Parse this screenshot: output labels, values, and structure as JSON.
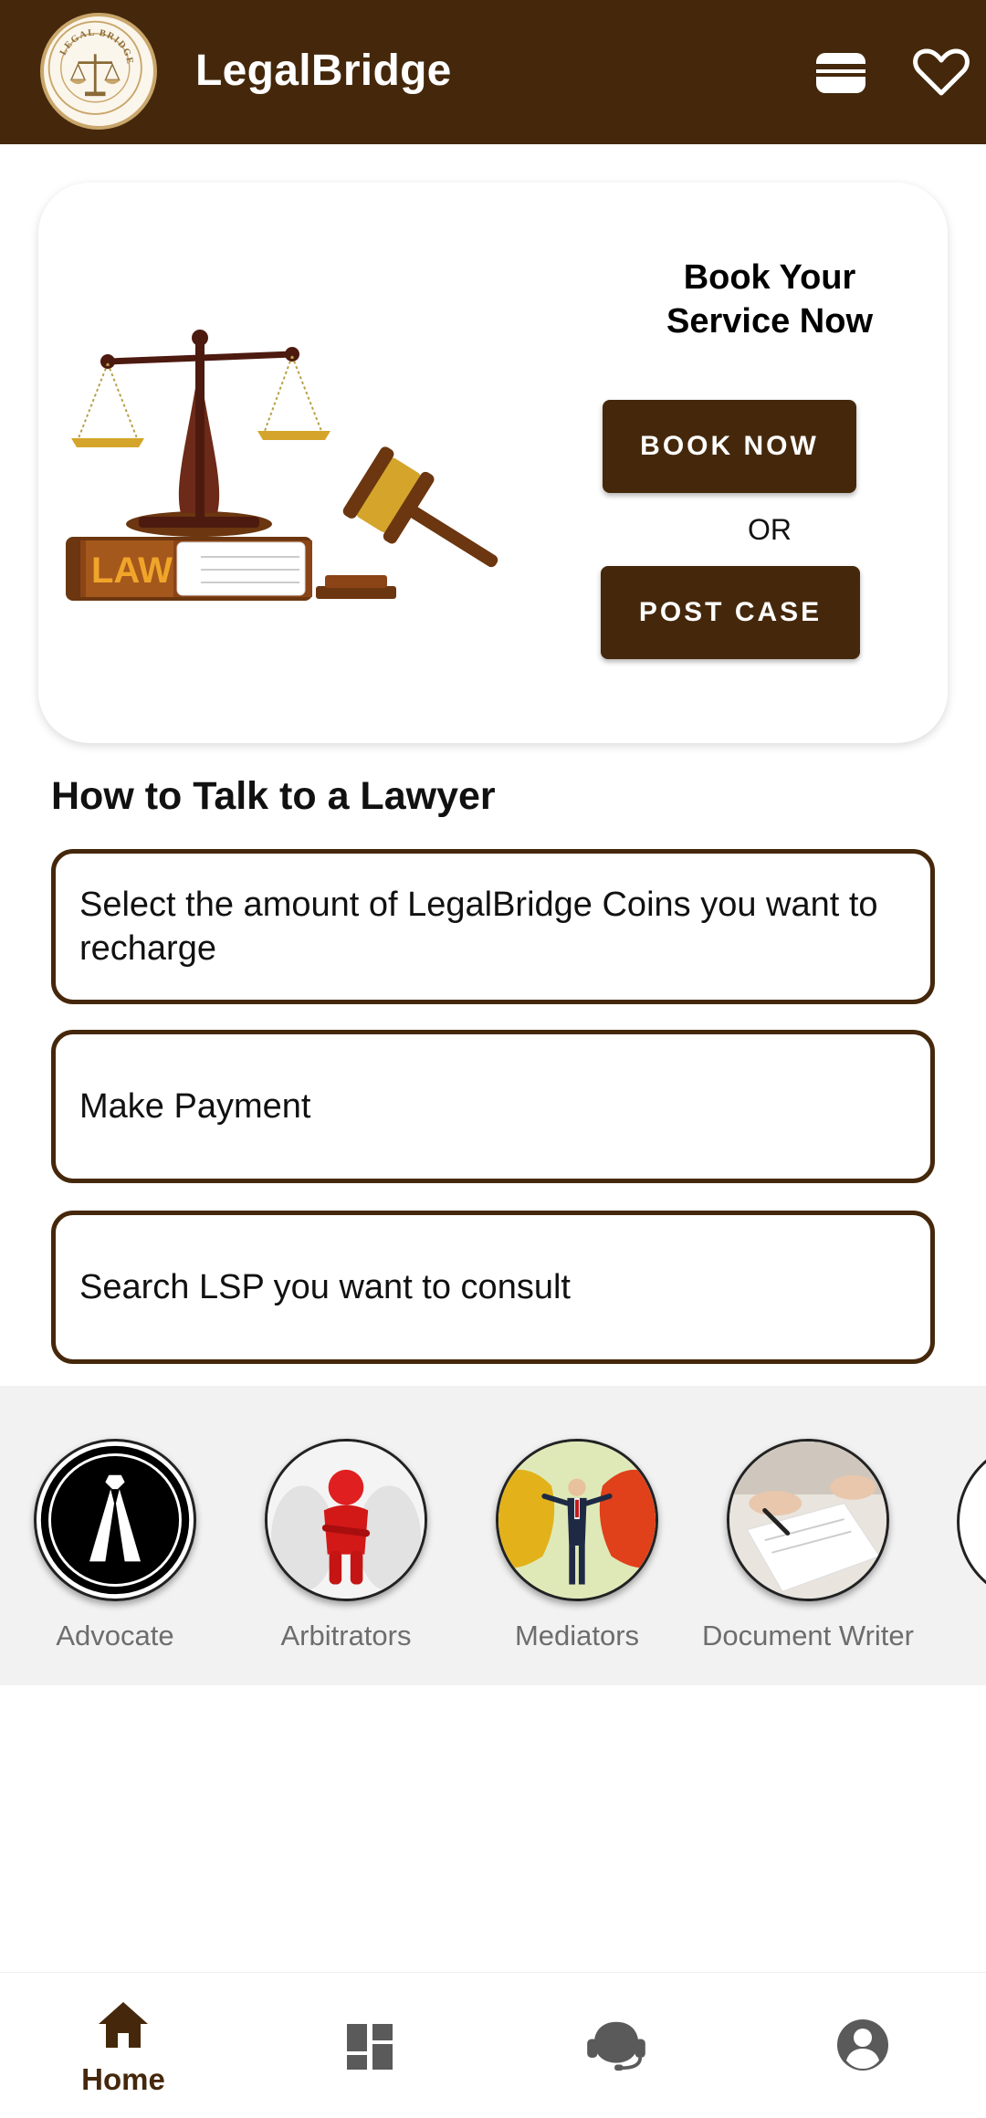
{
  "header": {
    "app_title": "LegalBridge",
    "logo_text": "LEGAL BRIDGE",
    "wallet_icon": "wallet-icon",
    "favorite_icon": "heart-icon",
    "background_color": "#45280b"
  },
  "booking_card": {
    "headline_line1": "Book Your",
    "headline_line2": "Service Now",
    "book_button_label": "BOOK NOW",
    "or_text": "OR",
    "post_button_label": "POST CASE",
    "illustration_book_text": "LAW"
  },
  "how_to": {
    "title": "How to Talk to a Lawyer",
    "steps": [
      "Select the amount of LegalBridge Coins you want to recharge",
      "Make Payment",
      "Search LSP you want to consult"
    ]
  },
  "categories": [
    {
      "label": "Advocate",
      "icon": "advocate-band-icon"
    },
    {
      "label": "Arbitrators",
      "icon": "arbitrator-figure-icon"
    },
    {
      "label": "Mediators",
      "icon": "mediator-figure-icon"
    },
    {
      "label": "Document Writer",
      "icon": "document-writer-icon"
    }
  ],
  "bottom_nav": {
    "items": [
      {
        "label": "Home",
        "icon": "home-icon",
        "active": true
      },
      {
        "label": "",
        "icon": "dashboard-icon",
        "active": false
      },
      {
        "label": "",
        "icon": "support-headset-icon",
        "active": false
      },
      {
        "label": "",
        "icon": "profile-icon",
        "active": false
      }
    ]
  },
  "colors": {
    "brand_brown": "#45280b",
    "gold": "#c9a66b",
    "category_label": "#6d6d6d"
  }
}
